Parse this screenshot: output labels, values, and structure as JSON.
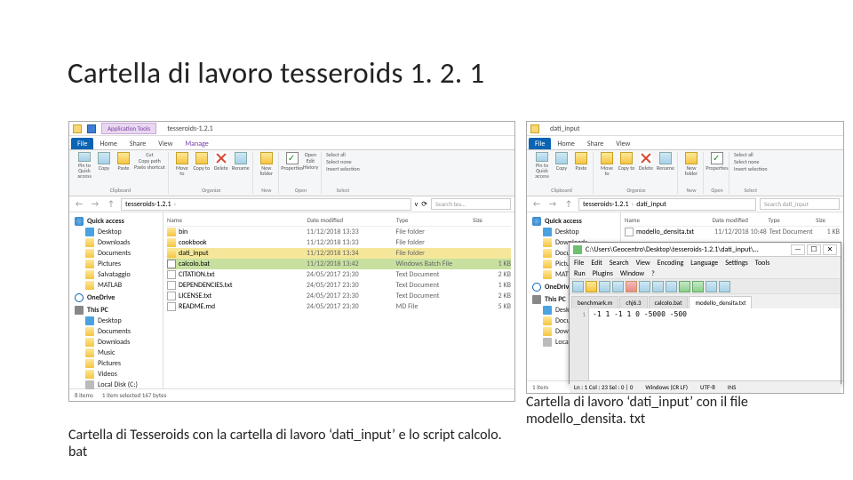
{
  "slide_title": "Cartella di lavoro tesseroids 1. 2. 1",
  "pane1": {
    "title": "tesseroids-1.2.1",
    "app_tools": "Application Tools",
    "tabs": {
      "file": "File",
      "home": "Home",
      "share": "Share",
      "view": "View",
      "manage": "Manage"
    },
    "ribbon": {
      "pin": "Pin to Quick access",
      "copy": "Copy",
      "paste": "Paste",
      "cut": "Cut",
      "copypath": "Copy path",
      "shortcut": "Paste shortcut",
      "move": "Move to",
      "copyto": "Copy to",
      "delete": "Delete",
      "rename": "Rename",
      "newfolder": "New folder",
      "props": "Properties",
      "open": "Open",
      "edit": "Edit",
      "history": "History",
      "selectall": "Select all",
      "selectnone": "Select none",
      "invert": "Invert selection",
      "clipboard": "Clipboard",
      "organize": "Organize",
      "new": "New",
      "opengrp": "Open",
      "select": "Select"
    },
    "crumb": [
      "tesseroids-1.2.1"
    ],
    "search_ph": "Search tes…",
    "sidebar": {
      "quick": "Quick access",
      "desktop": "Desktop",
      "downloads": "Downloads",
      "documents": "Documents",
      "pictures": "Pictures",
      "salvataggio": "Salvataggio",
      "matlab": "MATLAB",
      "onedrive": "OneDrive",
      "thispc": "This PC",
      "desktop2": "Desktop",
      "documents2": "Documents",
      "downloads2": "Downloads",
      "music": "Music",
      "pictures2": "Pictures",
      "videos": "Videos",
      "localdisk": "Local Disk (C:)"
    },
    "columns": {
      "name": "Name",
      "date": "Date modified",
      "type": "Type",
      "size": "Size"
    },
    "rows": [
      {
        "icon": "folder",
        "name": "bin",
        "date": "11/12/2018 13:33",
        "type": "File folder",
        "size": ""
      },
      {
        "icon": "folder",
        "name": "cookbook",
        "date": "11/12/2018 13:33",
        "type": "File folder",
        "size": ""
      },
      {
        "icon": "folder",
        "name": "dati_input",
        "date": "11/12/2018 13:34",
        "type": "File folder",
        "size": "",
        "sel": "gold"
      },
      {
        "icon": "bat",
        "name": "calcolo.bat",
        "date": "11/12/2018 13:42",
        "type": "Windows Batch File",
        "size": "1 KB",
        "sel": "green"
      },
      {
        "icon": "txt",
        "name": "CITATION.txt",
        "date": "24/05/2017 23:30",
        "type": "Text Document",
        "size": "2 KB"
      },
      {
        "icon": "txt",
        "name": "DEPENDENCIES.txt",
        "date": "24/05/2017 23:30",
        "type": "Text Document",
        "size": "1 KB"
      },
      {
        "icon": "txt",
        "name": "LICENSE.txt",
        "date": "24/05/2017 23:30",
        "type": "Text Document",
        "size": "2 KB"
      },
      {
        "icon": "md",
        "name": "README.md",
        "date": "24/05/2017 23:30",
        "type": "MD File",
        "size": "5 KB"
      }
    ],
    "status": {
      "items": "8 items",
      "sel": "1 item selected 167 bytes"
    }
  },
  "pane2": {
    "title": "dati_input",
    "crumb": [
      "tesseroids-1.2.1",
      "dati_input"
    ],
    "search_ph": "Search dati_input",
    "columns": {
      "name": "Name",
      "date": "Date modified",
      "type": "Type",
      "size": "Size"
    },
    "rows": [
      {
        "icon": "txt",
        "name": "modello_densita.txt",
        "date": "11/12/2018 10:48",
        "type": "Text Document",
        "size": "1 KB"
      }
    ],
    "status": {
      "items": "1 item"
    }
  },
  "editor": {
    "title_path": "C:\\Users\\Geocentro\\Desktop\\tesseroids-1.2.1\\dati_input\\…",
    "menu": [
      "File",
      "Edit",
      "Search",
      "View",
      "Encoding",
      "Language",
      "Settings",
      "Tools"
    ],
    "menu2": [
      "Run",
      "Plugins",
      "Window",
      "?"
    ],
    "tabs": [
      {
        "label": "benchmark.m"
      },
      {
        "label": "chj6.3"
      },
      {
        "label": "calcolo.bat"
      },
      {
        "label": "modello_densita.txt",
        "active": true
      }
    ],
    "content_line1": "1",
    "content_text": "-1 1 -1 1 0 -5000 -500",
    "status": {
      "ln": "Ln : 1  Col : 23  Sel : 0 | 0",
      "enc": "Windows (CR LF)",
      "charset": "UTF-8",
      "ins": "INS"
    }
  },
  "caption1": "Cartella di lavoro ‘dati_input’ con il file modello_densita. txt",
  "caption2": "Cartella di Tesseroids con la cartella di lavoro ‘dati_input’ e lo script calcolo. bat"
}
